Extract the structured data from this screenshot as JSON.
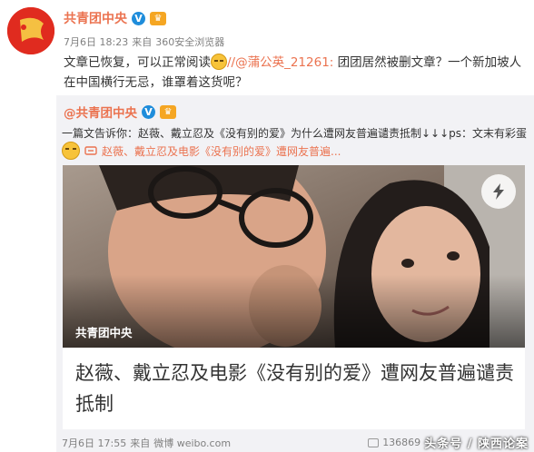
{
  "post": {
    "author": "共青团中央",
    "verified_badge": "V",
    "meta": {
      "date": "7月6日 18:23",
      "from_prefix": "来自",
      "client": "360安全浏览器"
    },
    "text_part1": "文章已恢复，可以正常阅读",
    "text_link": "//@蒲公英_21261:",
    "text_part2": " 团团居然被删文章？一个新加坡人在中国横行无忌，谁罩着这货呢？"
  },
  "repost": {
    "author": "@共青团中央",
    "verified_badge": "V",
    "text": "一篇文告诉你：赵薇、戴立忍及《没有别的爱》为什么遭网友普遍谴责抵制↓↓↓ps：文末有彩蛋",
    "link_text": "赵薇、戴立忍及电影《没有别的爱》遭网友普遍...",
    "card": {
      "source": "共青团中央",
      "title": "赵薇、戴立忍及电影《没有别的爱》遭网友普遍谴责抵制"
    },
    "footer": {
      "date": "7月6日 17:55",
      "from_prefix": "来自",
      "client": "微博 weibo.com",
      "repost_count": "136869",
      "watermark": "头条号 / 陕西论案"
    }
  },
  "icons": {
    "avatar": "flag-avatar-icon",
    "verified": "verified-v-icon",
    "member": "member-crown-icon",
    "emoji": "smile-emoji-icon",
    "link": "link-icon",
    "flash": "lightning-icon",
    "repost": "repost-icon"
  },
  "colors": {
    "accent": "#eb7350",
    "verified": "#1f8ddb",
    "repost_bg": "#f2f2f5",
    "avatar_bg": "#e02b1f"
  }
}
